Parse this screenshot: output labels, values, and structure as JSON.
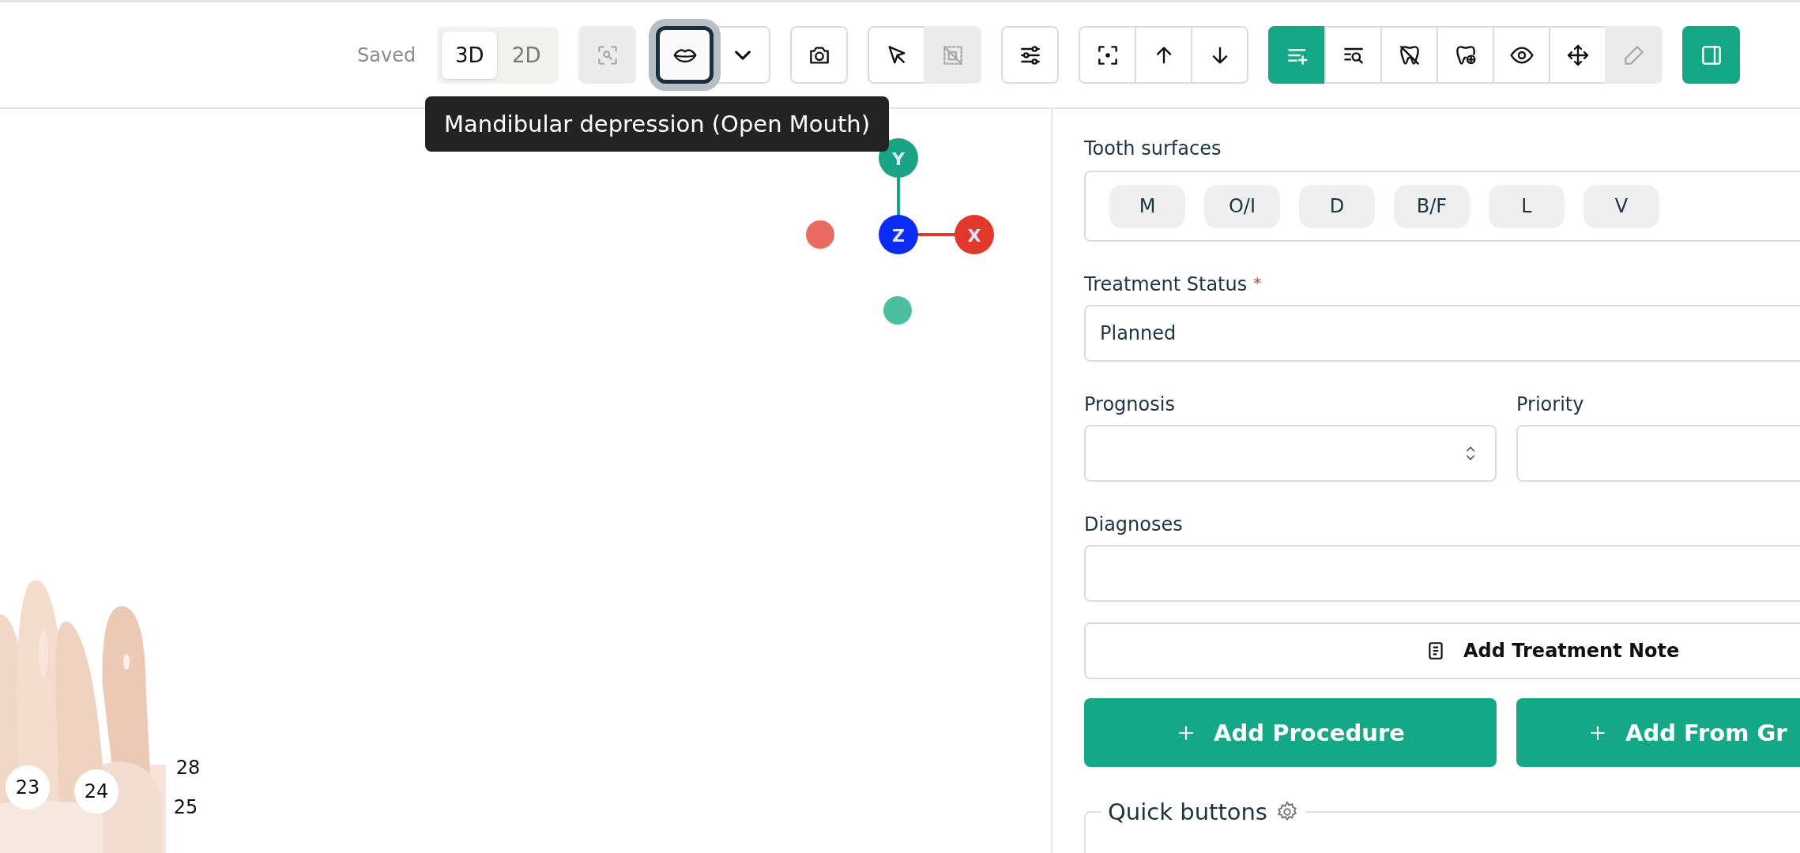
{
  "toolbar": {
    "save_status": "Saved",
    "view_modes": [
      {
        "label": "3D",
        "selected": true
      },
      {
        "label": "2D",
        "selected": false
      }
    ],
    "tool_groups": [
      [
        {
          "kind": "zoom-area",
          "active": false,
          "disabled": true,
          "focused": false
        }
      ],
      [
        {
          "kind": "lips",
          "active": false,
          "disabled": false,
          "focused": true
        },
        {
          "kind": "caret",
          "active": false,
          "disabled": false,
          "focused": false
        }
      ],
      [
        {
          "kind": "camera",
          "active": false,
          "disabled": false,
          "focused": false
        }
      ],
      [
        {
          "kind": "cursor",
          "active": false,
          "disabled": false,
          "focused": false
        },
        {
          "kind": "deselect",
          "active": false,
          "disabled": true,
          "focused": false
        }
      ],
      [
        {
          "kind": "sliders",
          "active": false,
          "disabled": false,
          "focused": false
        }
      ],
      [
        {
          "kind": "focus",
          "active": false,
          "disabled": false,
          "focused": false
        },
        {
          "kind": "arrow-up",
          "active": false,
          "disabled": false,
          "focused": false
        },
        {
          "kind": "arrow-down",
          "active": false,
          "disabled": false,
          "focused": false
        }
      ],
      [
        {
          "kind": "list-add",
          "active": true,
          "disabled": false,
          "focused": false
        },
        {
          "kind": "list-search",
          "active": false,
          "disabled": false,
          "focused": false
        },
        {
          "kind": "tooth-off",
          "active": false,
          "disabled": false,
          "focused": false
        },
        {
          "kind": "tooth-add",
          "active": false,
          "disabled": false,
          "focused": false
        },
        {
          "kind": "eye",
          "active": false,
          "disabled": false,
          "focused": false
        },
        {
          "kind": "move",
          "active": false,
          "disabled": false,
          "focused": false
        },
        {
          "kind": "pencil",
          "active": false,
          "disabled": true,
          "focused": false
        }
      ],
      [
        {
          "kind": "panel",
          "active": true,
          "disabled": false,
          "focused": false
        }
      ]
    ],
    "tooltip": "Mandibular depression (Open Mouth)"
  },
  "viewport": {
    "axis_labels": [
      "Y",
      "Z",
      "X"
    ],
    "tooth_labels": [
      "23",
      "24",
      "28",
      "25"
    ]
  },
  "treatment_form": {
    "tooth_surfaces": {
      "label": "Tooth surfaces",
      "options": [
        {
          "label": "M",
          "selected": false
        },
        {
          "label": "O/I",
          "selected": false
        },
        {
          "label": "D",
          "selected": false
        },
        {
          "label": "B/F",
          "selected": false
        },
        {
          "label": "L",
          "selected": false
        },
        {
          "label": "V",
          "selected": false
        }
      ]
    },
    "treatment_status": {
      "label": "Treatment Status",
      "required_mark": "*",
      "value": "Planned"
    },
    "prognosis": {
      "label": "Prognosis"
    },
    "priority": {
      "label": "Priority"
    },
    "diagnoses": {
      "label": "Diagnoses"
    },
    "add_note_button": "Add Treatment Note",
    "action_buttons": [
      "Add Procedure",
      "Add From Gr"
    ],
    "quick_buttons": {
      "title": "Quick buttons"
    }
  }
}
